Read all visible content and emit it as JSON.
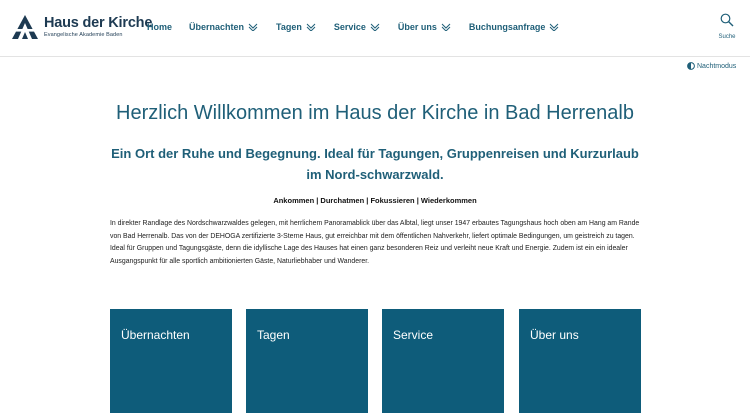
{
  "brand": {
    "name": "Haus der Kirche",
    "subtitle": "Evangelische Akademie Baden",
    "color": "#1d3a52"
  },
  "nav": {
    "home": "Home",
    "items": [
      {
        "label": "Übernachten",
        "dropdown": true
      },
      {
        "label": "Tagen",
        "dropdown": true
      },
      {
        "label": "Service",
        "dropdown": true
      },
      {
        "label": "Über uns",
        "dropdown": true
      },
      {
        "label": "Buchungsanfrage",
        "dropdown": true
      }
    ]
  },
  "search": {
    "label": "Suche",
    "icon": "search-icon"
  },
  "night_mode": {
    "label": "Nachtmodus",
    "icon": "half-moon-icon"
  },
  "hero": {
    "title": "Herzlich Willkommen im Haus der Kirche in Bad Herrenalb",
    "subtitle": "Ein Ort der Ruhe und Begegnung. Ideal für Tagungen, Gruppenreisen und Kurzurlaub im Nord-schwarzwald.",
    "tagline": "Ankommen | Durchatmen | Fokussieren | Wiederkommen",
    "intro": "In direkter Randlage des Nordschwarzwaldes gelegen, mit herrlichem Panoramablick über das Albtal, liegt unser 1947 erbautes Tagungshaus hoch oben am Hang am Rande von Bad Herrenalb. Das von der DEHOGA zertifizierte 3-Sterne Haus, gut erreichbar mit dem öffentlichen Nahverkehr, liefert optimale Bedingungen, um geistreich zu tagen. Ideal für Gruppen und Tagungsgäste, denn die idyllische Lage des Hauses hat einen ganz besonderen Reiz und verleiht neue Kraft und Energie. Zudem ist ein ein idealer Ausgangspunkt für alle sportlich ambitionierten Gäste, Naturliebhaber und Wanderer."
  },
  "tiles": [
    {
      "label": "Übernachten"
    },
    {
      "label": "Tagen"
    },
    {
      "label": "Service"
    },
    {
      "label": "Über uns"
    }
  ],
  "colors": {
    "accent": "#1f5f78",
    "tile": "#0e5c7a"
  }
}
